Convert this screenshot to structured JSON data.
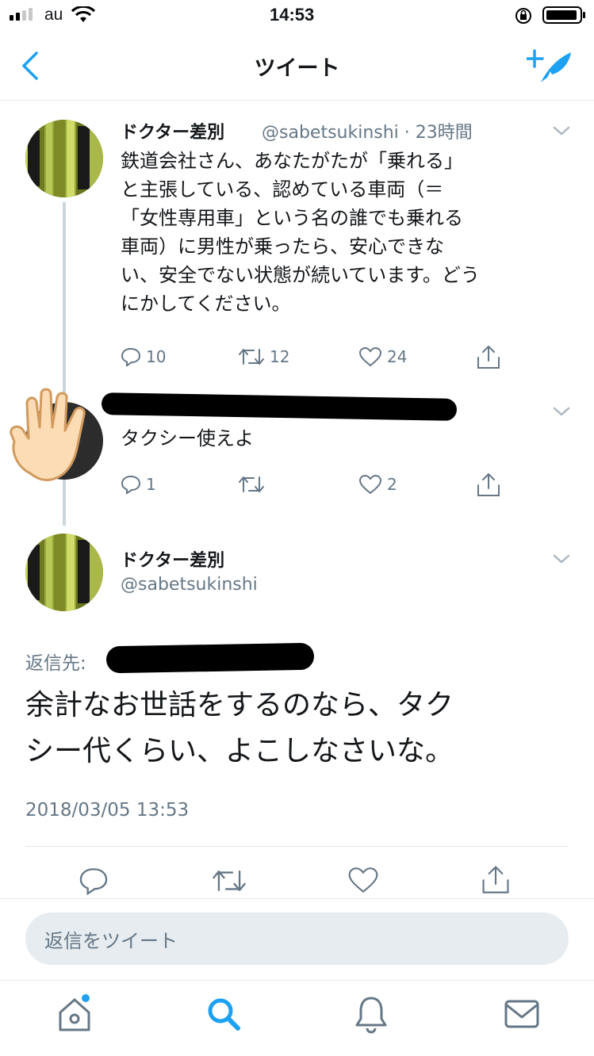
{
  "status_bar": {
    "carrier": "au",
    "time": "14:53"
  },
  "nav": {
    "title": "ツイート"
  },
  "tweet1": {
    "name": "ドクター差別",
    "handle_time": "@sabetsukinshi · 23時間",
    "body_lines": [
      "鉄道会社さん、あなたがたが「乗れる」",
      "と主張している、認めている車両（＝",
      "「女性専用車」という名の誰でも乗れる",
      "車両）に男性が乗ったら、安心できな",
      "い、安全でない状態が続いています。どう",
      "にかしてください。"
    ],
    "reply_count": "10",
    "retweet_count": "12",
    "like_count": "24"
  },
  "tweet2": {
    "body": "タクシー使えよ",
    "reply_count": "1",
    "like_count": "2"
  },
  "main_tweet": {
    "name": "ドクター差別",
    "handle": "@sabetsukinshi",
    "reply_to_label": "返信先:",
    "body_lines": [
      "余計なお世話をするのなら、タク",
      "シー代くらい、よこしなさいな。"
    ],
    "timestamp": "2018/03/05 13:53"
  },
  "reply_input": {
    "placeholder": "返信をツイート"
  },
  "tab_bar": {
    "items": [
      "home",
      "search",
      "notifications",
      "messages"
    ]
  },
  "colors": {
    "accent": "#1da1f2",
    "muted": "#657786",
    "border": "#e1e8ed"
  }
}
